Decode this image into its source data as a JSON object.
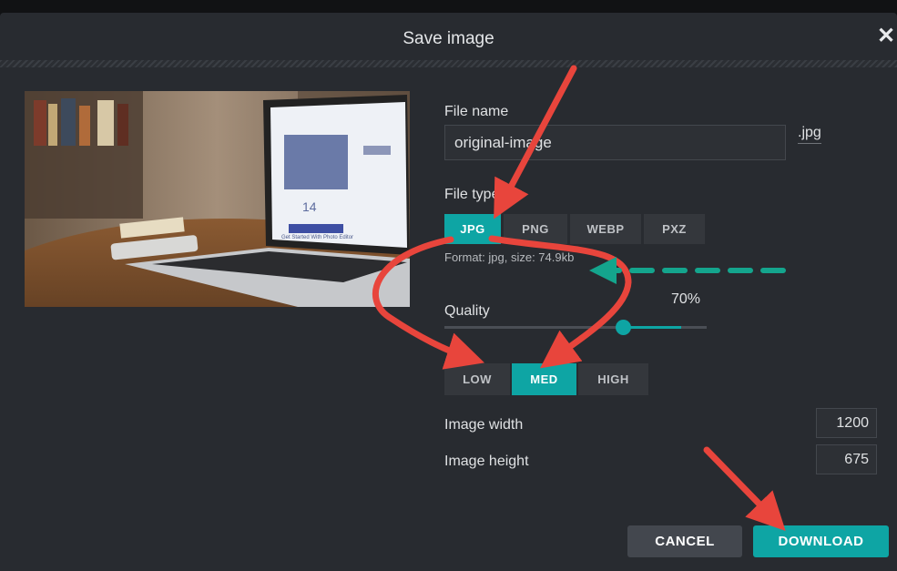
{
  "dialog": {
    "title": "Save image",
    "close_glyph": "✕"
  },
  "file_name": {
    "label": "File name",
    "value": "original-image",
    "extension": ".jpg"
  },
  "file_type": {
    "label": "File type",
    "options": [
      "JPG",
      "PNG",
      "WEBP",
      "PXZ"
    ],
    "selected": "JPG",
    "format_info": "Format: jpg, size: 74.9kb"
  },
  "quality": {
    "label": "Quality",
    "value_text": "70%",
    "value": 0.7,
    "presets": [
      "LOW",
      "MED",
      "HIGH"
    ],
    "selected_preset": "MED"
  },
  "dimensions": {
    "width_label": "Image width",
    "width_value": "1200",
    "height_label": "Image height",
    "height_value": "675"
  },
  "buttons": {
    "cancel": "CANCEL",
    "download": "DOWNLOAD"
  },
  "preview": {
    "screen_heading": "14",
    "screen_caption": "Get Started With Photo Editor"
  },
  "colors": {
    "accent": "#0ea5a4",
    "annotation_arrow": "#e8453c",
    "annotation_dashed_arrow": "#14a58d"
  }
}
